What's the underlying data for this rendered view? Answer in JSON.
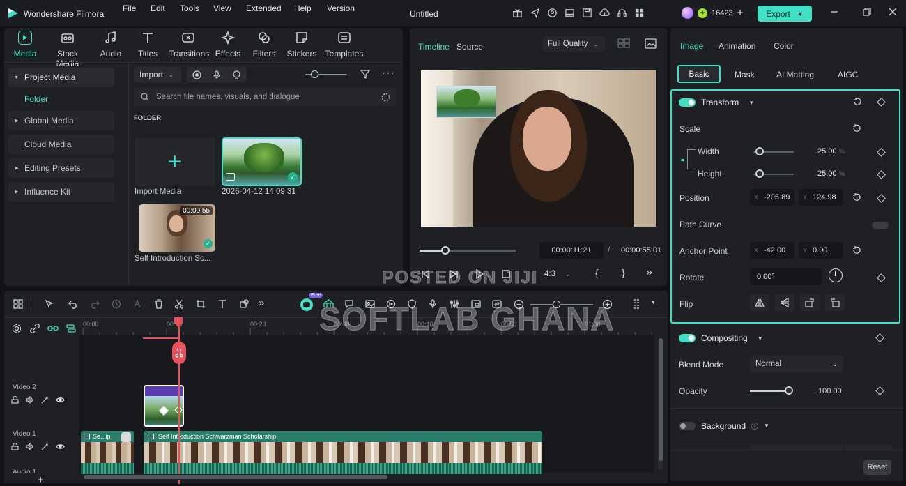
{
  "app": {
    "name": "Wondershare Filmora",
    "menu": [
      "File",
      "Edit",
      "Tools",
      "View",
      "Extended",
      "Help",
      "Version"
    ],
    "doc_title": "Untitled",
    "credits": "16423",
    "export_label": "Export"
  },
  "toolbar": {
    "tabs": [
      "Media",
      "Stock Media",
      "Audio",
      "Titles",
      "Transitions",
      "Effects",
      "Filters",
      "Stickers",
      "Templates"
    ]
  },
  "sidebar": {
    "items": [
      {
        "label": "Project Media"
      },
      {
        "label": "Folder"
      },
      {
        "label": "Global Media"
      },
      {
        "label": "Cloud Media"
      },
      {
        "label": "Editing Presets"
      },
      {
        "label": "Influence Kit"
      }
    ]
  },
  "media": {
    "import_label": "Import",
    "search_placeholder": "Search file names, visuals, and dialogue",
    "folder_heading": "FOLDER",
    "import_media_label": "Import Media",
    "items": [
      {
        "name": "2026-04-12 14 09 31"
      },
      {
        "name": "Self Introduction Sc...",
        "duration": "00:00:55"
      }
    ]
  },
  "player": {
    "tabs": [
      "Timeline",
      "Source"
    ],
    "quality": "Full Quality",
    "current_time": "00:00:11:21",
    "separator": "/",
    "total_time": "00:00:55:01",
    "aspect": "4:3",
    "progress": 0.27
  },
  "inspector": {
    "tabs": [
      "Image",
      "Animation",
      "Color"
    ],
    "subtabs": [
      "Basic",
      "Mask",
      "AI Matting",
      "AIGC"
    ],
    "transform": {
      "title": "Transform",
      "scale_label": "Scale",
      "width_label": "Width",
      "width_value": "25.00",
      "height_label": "Height",
      "height_value": "25.00",
      "unit": "%",
      "position_label": "Position",
      "pos_x_label": "X",
      "pos_x": "-205.89",
      "pos_y_label": "Y",
      "pos_y": "124.98",
      "path_curve_label": "Path Curve",
      "anchor_label": "Anchor Point",
      "anchor_x_label": "X",
      "anchor_x": "-42.00",
      "anchor_y_label": "Y",
      "anchor_y": "0.00",
      "rotate_label": "Rotate",
      "rotate_value": "0.00°",
      "flip_label": "Flip"
    },
    "compositing": {
      "title": "Compositing",
      "blend_label": "Blend Mode",
      "blend_value": "Normal",
      "opacity_label": "Opacity",
      "opacity_value": "100.00"
    },
    "background": {
      "title": "Background"
    },
    "reset_label": "Reset"
  },
  "timeline": {
    "free_badge": "Free",
    "ruler": [
      "00:00",
      "00:10",
      "00:20",
      "00:30",
      "00:40",
      "00:50",
      "01:00"
    ],
    "tracks": [
      {
        "label": "Video 2"
      },
      {
        "label": "Video 1"
      },
      {
        "label": "Audio 1"
      }
    ],
    "clips": [
      {
        "label": "Se...ip"
      },
      {
        "label": "Self Introduction Schwarzman Scholarship"
      }
    ]
  },
  "watermark": {
    "line1": "POSTED ON JIJI",
    "line2": "SOFTLAB GHANA"
  },
  "colors": {
    "accent": "#3fe0c5",
    "playhead": "#e8505b",
    "clip_green": "#2a7d6a"
  }
}
